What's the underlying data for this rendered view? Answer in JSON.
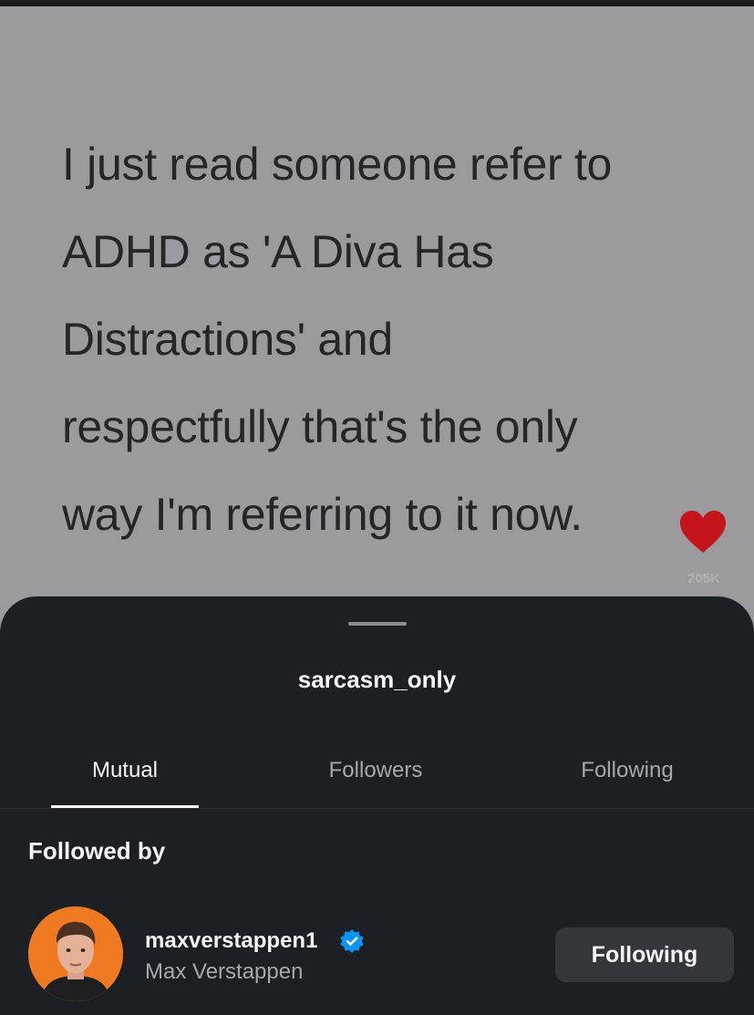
{
  "post": {
    "quote": "I just read someone refer to\nADHD as 'A Diva Has\nDistractions' and\nrespectfully that's the only\nway I'm referring to it now.",
    "like_count": "205K",
    "heart_color": "#c4151c"
  },
  "sheet": {
    "title": "sarcasm_only",
    "tabs": [
      {
        "label": "Mutual",
        "active": true
      },
      {
        "label": "Followers",
        "active": false
      },
      {
        "label": "Following",
        "active": false
      }
    ],
    "section_label": "Followed by",
    "users": [
      {
        "username": "maxverstappen1",
        "verified": true,
        "full_name": "Max Verstappen",
        "button_label": "Following",
        "avatar_bg": "#f07a22"
      }
    ]
  },
  "colors": {
    "background_post": "#9b9b9d",
    "sheet_bg": "#1c1f23",
    "verified_blue": "#0095f6"
  },
  "icons": {
    "like": "heart-icon",
    "verified": "verified-badge-icon"
  }
}
